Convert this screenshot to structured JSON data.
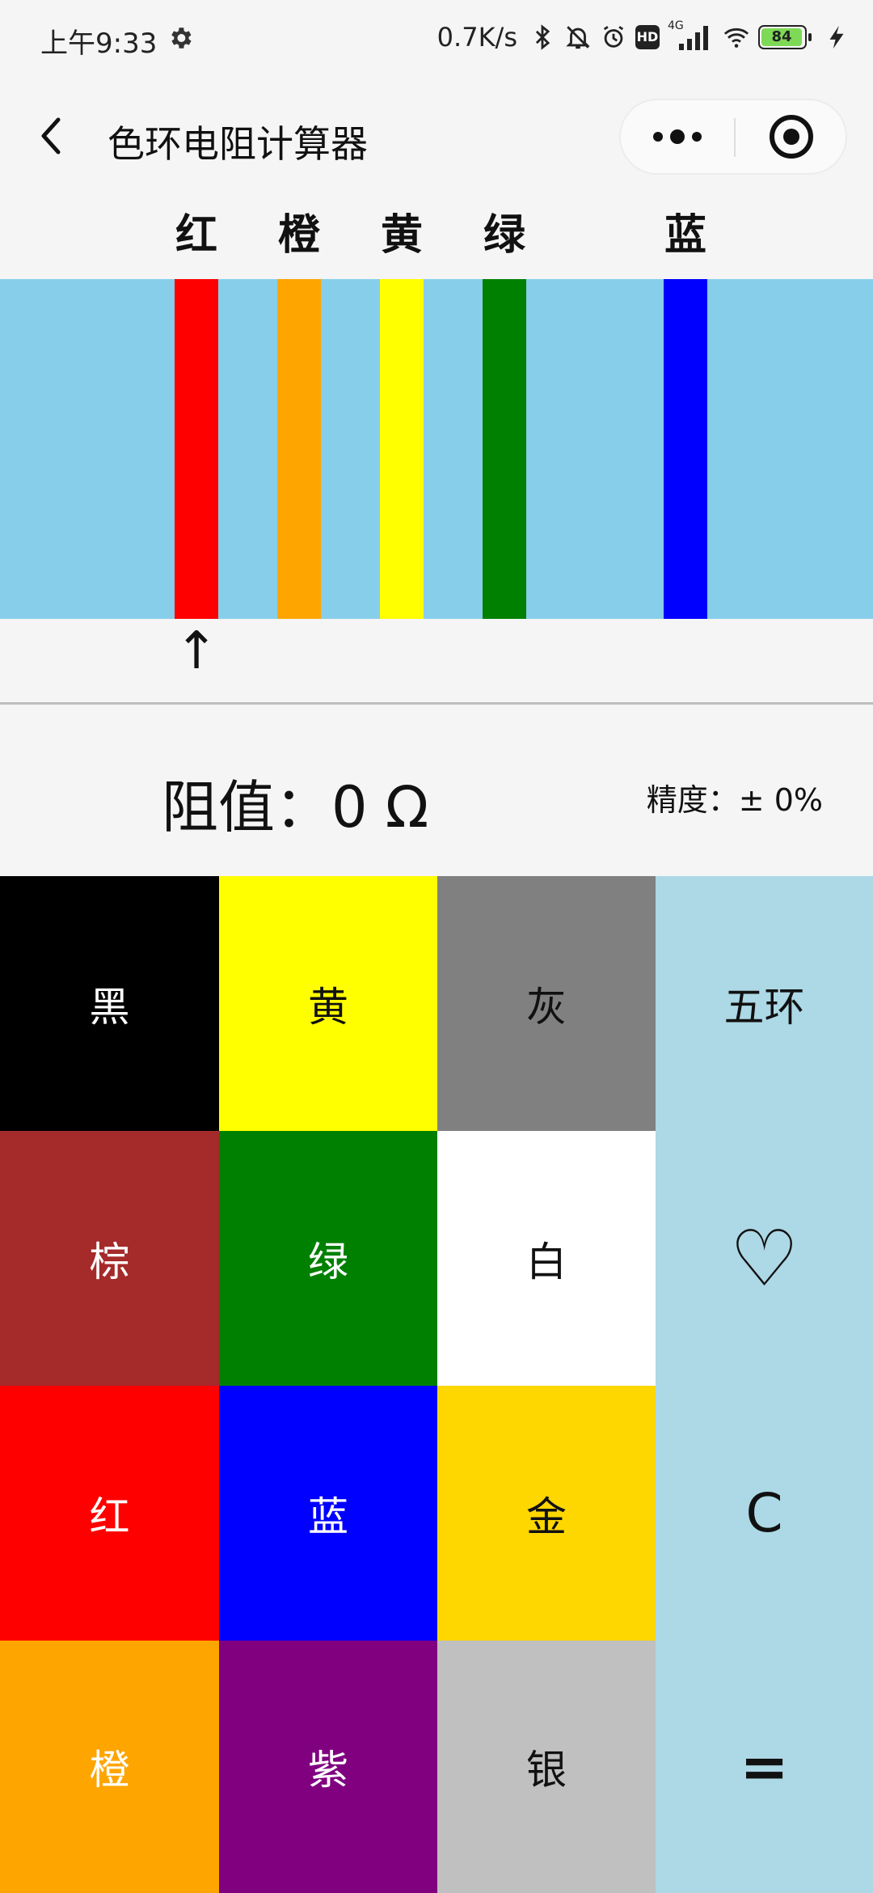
{
  "status_bar": {
    "time": "上午9:33",
    "net_speed": "0.7K/s",
    "hd_badge": "HD",
    "network_type": "4G",
    "battery": "84"
  },
  "nav": {
    "title": "色环电阻计算器"
  },
  "bands": [
    {
      "label": "红",
      "color": "#ff0000"
    },
    {
      "label": "橙",
      "color": "#ffa500"
    },
    {
      "label": "黄",
      "color": "#ffff00"
    },
    {
      "label": "绿",
      "color": "#008000"
    },
    {
      "label": "蓝",
      "color": "#0000ff"
    }
  ],
  "resistor_body_color": "#87ceeb",
  "selected_band_index": 0,
  "selector_arrow": "↑",
  "result": {
    "resistance_text": "阻值：0 Ω",
    "precision_text": "精度：± 0%"
  },
  "keypad": {
    "color_keys": [
      {
        "label": "黑",
        "color": "#000000",
        "text_color": "#ffffff"
      },
      {
        "label": "黄",
        "color": "#ffff00",
        "text_color": "#111111"
      },
      {
        "label": "灰",
        "color": "#808080",
        "text_color": "#111111"
      },
      {
        "label": "棕",
        "color": "#a52a2a",
        "text_color": "#ffffff"
      },
      {
        "label": "绿",
        "color": "#008000",
        "text_color": "#ffffff"
      },
      {
        "label": "白",
        "color": "#ffffff",
        "text_color": "#111111"
      },
      {
        "label": "红",
        "color": "#ff0000",
        "text_color": "#ffffff"
      },
      {
        "label": "蓝",
        "color": "#0000ff",
        "text_color": "#ffffff"
      },
      {
        "label": "金",
        "color": "#ffd700",
        "text_color": "#111111"
      },
      {
        "label": "橙",
        "color": "#ffa500",
        "text_color": "#ffffff"
      },
      {
        "label": "紫",
        "color": "#800080",
        "text_color": "#ffffff"
      },
      {
        "label": "银",
        "color": "#c0c0c0",
        "text_color": "#111111"
      }
    ],
    "side_keys": {
      "mode": "五环",
      "favorite": "♡",
      "clear": "C",
      "equals": "="
    },
    "side_color": "#add8e6"
  }
}
